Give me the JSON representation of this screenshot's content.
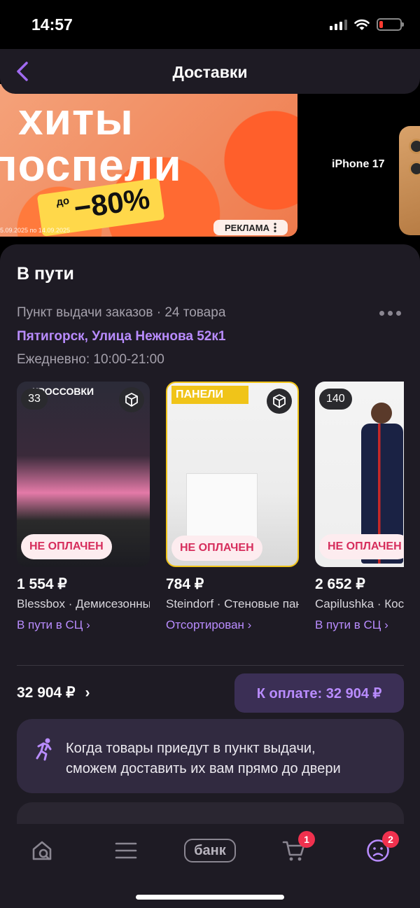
{
  "status_bar": {
    "time": "14:57"
  },
  "header": {
    "title": "Доставки"
  },
  "banner": {
    "line1": "хиты",
    "line2": "поспели",
    "badge_small": "до",
    "badge_big": "−80%",
    "dates": "5.09.2025 по 14.09.2025",
    "ad_label": "РЕКЛАМА",
    "side_text": "iPhone 17"
  },
  "delivery": {
    "section_title": "В пути",
    "pickup_info": "Пункт выдачи заказов · 24 товара",
    "address": "Пятигорск, Улица Нежнова 52к1",
    "hours": "Ежедневно: 10:00-21:00",
    "products": [
      {
        "qty": "33",
        "unpaid_label": "НЕ ОПЛАЧЕН",
        "price": "1 554 ₽",
        "name": "Blessbox · Демисезонные",
        "status": "В пути в СЦ ›",
        "image_caption": "КРОССОВКИ"
      },
      {
        "qty": "",
        "unpaid_label": "НЕ ОПЛАЧЕН",
        "price": "784 ₽",
        "name": "Steindorf · Стеновые панели",
        "status": "Отсортирован ›",
        "image_caption": "ПАНЕЛИ"
      },
      {
        "qty": "140",
        "unpaid_label": "НЕ ОПЛАЧЕН",
        "price": "2 652 ₽",
        "name": "Capilushka · Костюм",
        "status": "В пути в СЦ ›",
        "image_caption": ""
      }
    ],
    "total": "32 904 ₽",
    "total_chevron": "›",
    "pay_button": "К оплате: 32 904 ₽",
    "info_line1": "Когда товары приедут в пункт выдачи,",
    "info_line2": "сможем доставить их вам прямо до двери"
  },
  "tab_bar": {
    "bank_label": "банк",
    "cart_badge": "1",
    "profile_badge": "2"
  },
  "colors": {
    "accent": "#b98cff",
    "unpaid_text": "#d62d5c",
    "badge": "#f0314e",
    "card_bg": "#1e1b24"
  }
}
